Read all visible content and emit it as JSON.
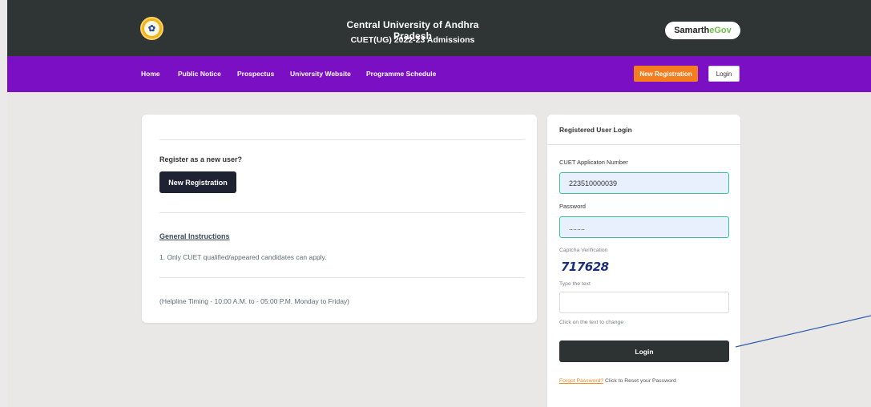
{
  "header": {
    "title": "Central University of Andhra Pradesh",
    "subtitle": "CUET(UG) 2022-23 Admissions",
    "brand_primary": "Samarth",
    "brand_secondary": "eGov",
    "logo_icon": "university-emblem-icon"
  },
  "nav": {
    "links": [
      "Home",
      "Public Notice",
      "Prospectus",
      "University Website",
      "Programme Schedule"
    ],
    "register_button": "New Registration",
    "login_button": "Login"
  },
  "register_panel": {
    "question": "Register as a new user?",
    "button": "New Registration",
    "instructions_heading": "General Instructions",
    "instructions": [
      "1. Only CUET qualified/appeared candidates can apply."
    ],
    "helpline": "(Helpline Timing - 10:00 A.M. to - 05:00 P.M. Monday to Friday)"
  },
  "login_panel": {
    "heading": "Registered User Login",
    "application_label": "CUET Applicaton Number",
    "application_value": "223510000039",
    "password_label": "Password",
    "password_value": "........",
    "captcha_label": "Captcha Verification",
    "captcha_text": "717628",
    "captcha_input_label": "Type the text",
    "captcha_hint": "Click on the text to change",
    "login_button": "Login",
    "forgot_link": "Forgot Password?",
    "forgot_text": "Click to Reset your Password"
  },
  "colors": {
    "header_bg": "#2f3434",
    "nav_bg": "#7a0fc4",
    "accent_orange": "#f57c1f",
    "field_border": "#3bbf97",
    "dark_button": "#1f2233",
    "annotation_line": "#2e5eab"
  }
}
